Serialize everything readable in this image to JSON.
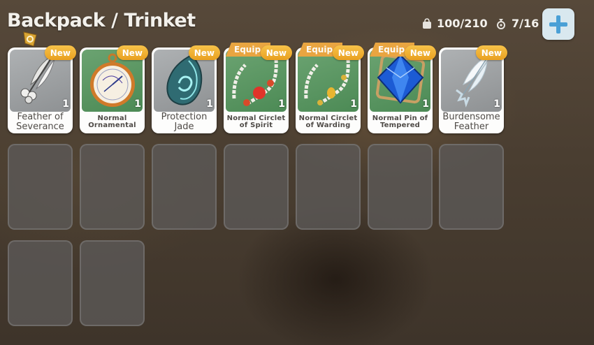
{
  "header": {
    "title": "Backpack / Trinket",
    "capacity": "100/210",
    "equipped_count": "7/16"
  },
  "badges": {
    "new": "New",
    "equipped": "Equip"
  },
  "items": [
    {
      "name": "Feather of Severance",
      "count": "1",
      "icon": "feather-icon",
      "bg": "grey",
      "new": true,
      "equipped": false
    },
    {
      "name": "Normal Ornamental",
      "count": "1",
      "icon": "pocket-watch-icon",
      "bg": "green",
      "new": true,
      "equipped": false
    },
    {
      "name": "Protection Jade",
      "count": "1",
      "icon": "jade-pendant-icon",
      "bg": "grey",
      "new": true,
      "equipped": false
    },
    {
      "name": "Normal Circlet of Spirit",
      "count": "1",
      "icon": "bead-necklace-red-icon",
      "bg": "green",
      "new": true,
      "equipped": true
    },
    {
      "name": "Normal Circlet of Warding",
      "count": "1",
      "icon": "bead-necklace-gold-icon",
      "bg": "green",
      "new": true,
      "equipped": true
    },
    {
      "name": "Normal Pin of Tempered",
      "count": "1",
      "icon": "blue-gem-pin-icon",
      "bg": "green",
      "new": true,
      "equipped": true
    },
    {
      "name": "Burdensome Feather",
      "count": "1",
      "icon": "white-feather-icon",
      "bg": "grey",
      "new": true,
      "equipped": false
    }
  ],
  "colors": {
    "new_badge": "#f2b43b",
    "equip_tag": "#e9a541",
    "green_bg": "#5b965f",
    "grey_bg": "#9c9fa1"
  }
}
